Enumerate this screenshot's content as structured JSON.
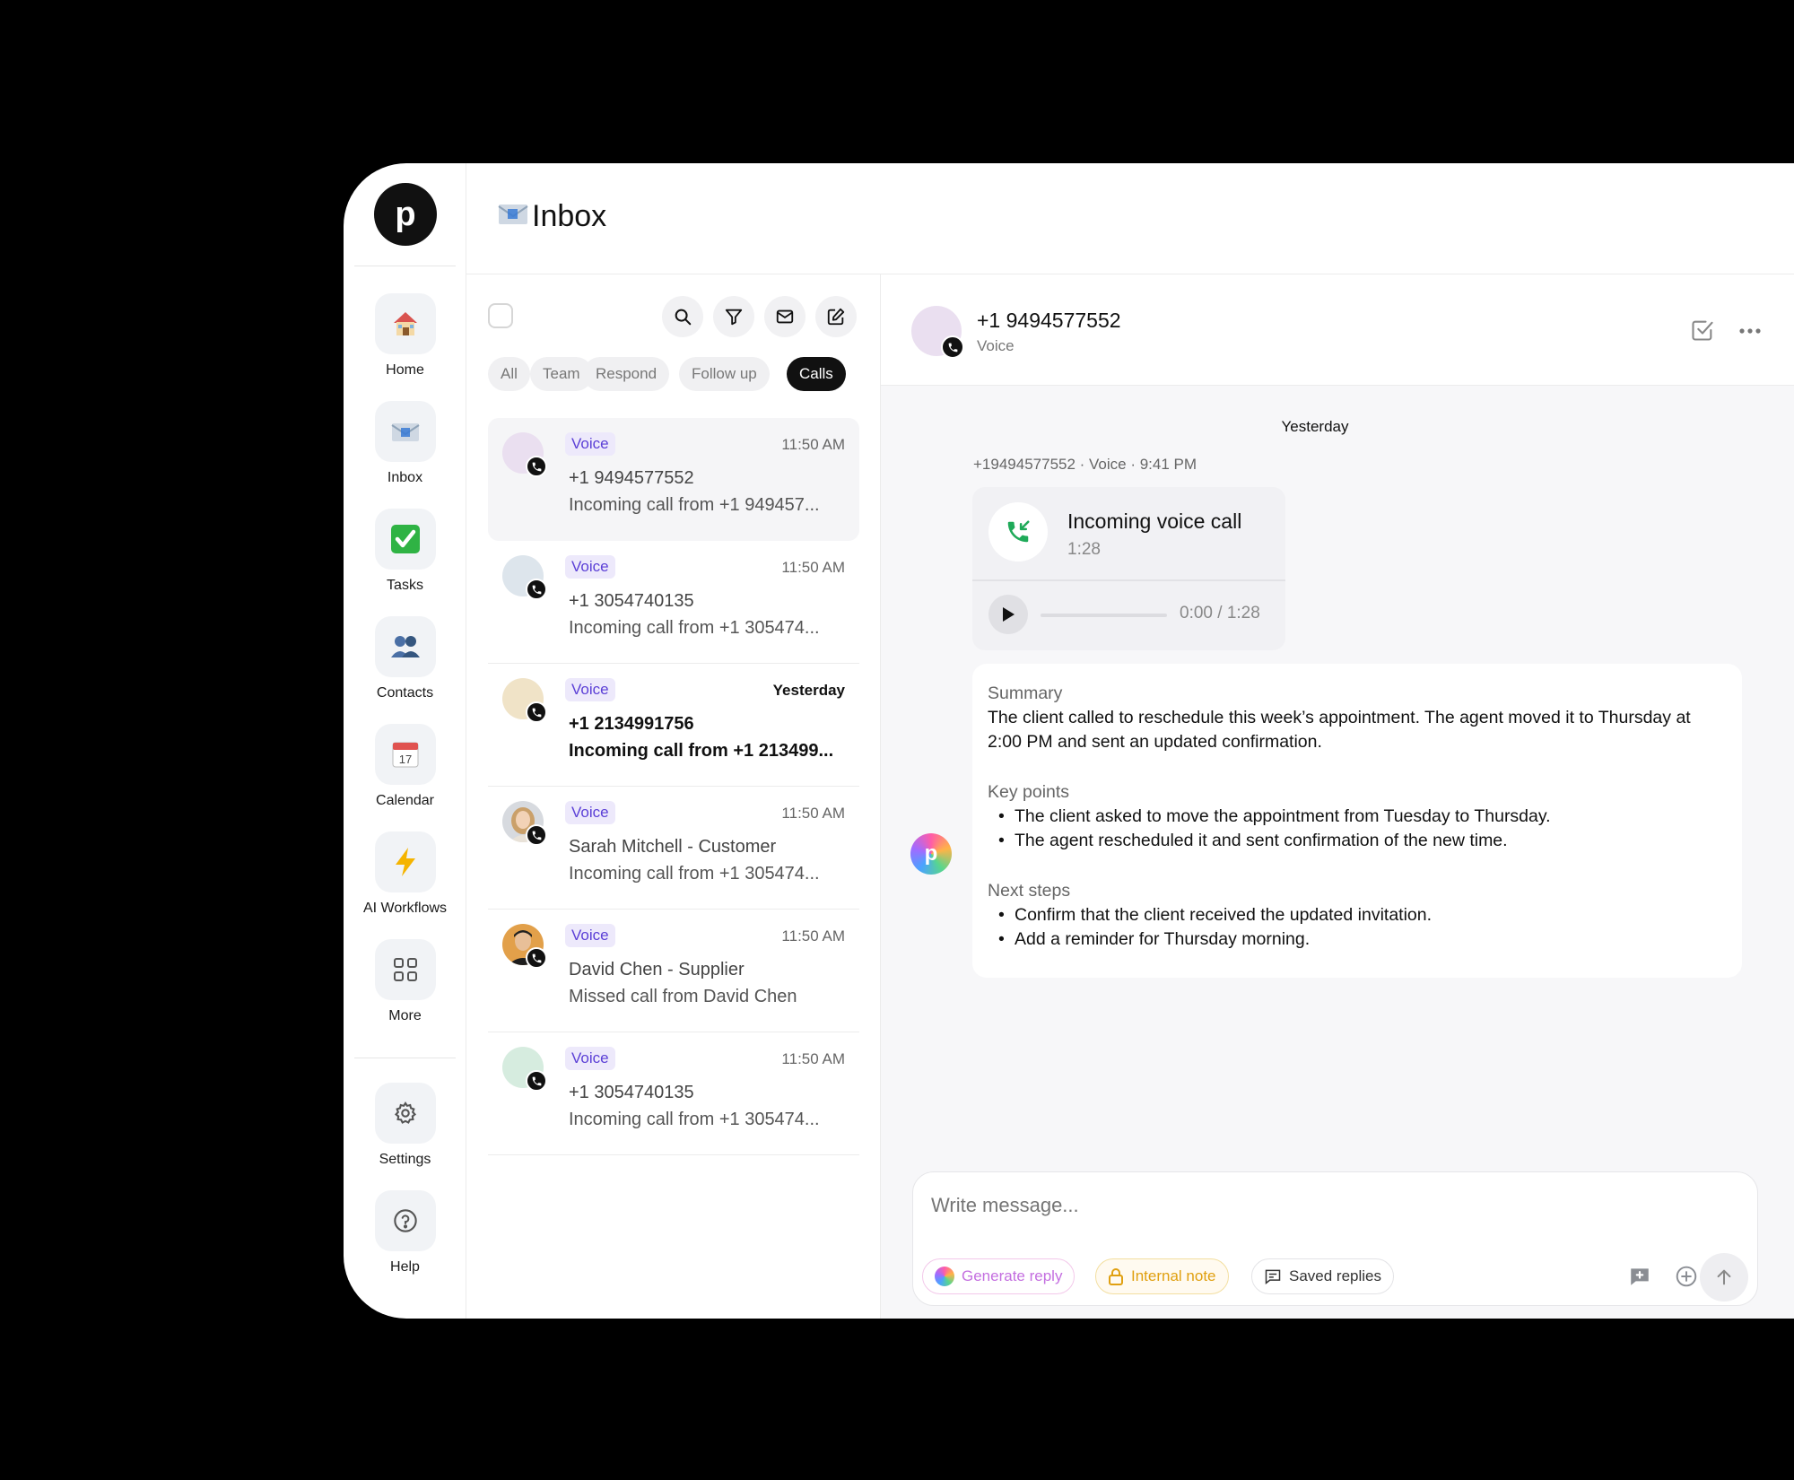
{
  "app": {
    "logo_letter": "p",
    "page_title": "Inbox",
    "accent_color": "#5b3fd6"
  },
  "sidebar": {
    "items": [
      {
        "label": "Home",
        "icon": "house-icon"
      },
      {
        "label": "Inbox",
        "icon": "inbox-icon"
      },
      {
        "label": "Tasks",
        "icon": "check-icon"
      },
      {
        "label": "Contacts",
        "icon": "contacts-icon"
      },
      {
        "label": "Calendar",
        "icon": "calendar-icon"
      },
      {
        "label": "AI Workflows",
        "icon": "lightning-icon"
      },
      {
        "label": "More",
        "icon": "grid-icon"
      }
    ],
    "bottom": [
      {
        "label": "Settings",
        "icon": "gear-icon"
      },
      {
        "label": "Help",
        "icon": "help-icon"
      }
    ]
  },
  "list": {
    "filters": [
      {
        "label": "All",
        "active": false
      },
      {
        "label": "Team",
        "active": false
      },
      {
        "label": "Respond",
        "active": false
      },
      {
        "label": "Follow up",
        "active": false
      },
      {
        "label": "Calls",
        "active": true
      }
    ],
    "conversations": [
      {
        "tag": "Voice",
        "time": "11:50 AM",
        "name": "+1 9494577552",
        "preview": "Incoming call from +1 949457...",
        "selected": true,
        "unread": false,
        "avatar_color": "#eadff0"
      },
      {
        "tag": "Voice",
        "time": "11:50 AM",
        "name": "+1 3054740135",
        "preview": "Incoming call from +1 305474...",
        "selected": false,
        "unread": false,
        "avatar_color": "#dde5ec"
      },
      {
        "tag": "Voice",
        "time": "Yesterday",
        "name": "+1 2134991756",
        "preview": "Incoming call from +1 213499...",
        "selected": false,
        "unread": true,
        "avatar_color": "#f0e3c7"
      },
      {
        "tag": "Voice",
        "time": "11:50 AM",
        "name": "Sarah Mitchell - Customer",
        "preview": "Incoming call from +1 305474...",
        "selected": false,
        "unread": false,
        "avatar_color": "#d9c3b0"
      },
      {
        "tag": "Voice",
        "time": "11:50 AM",
        "name": "David Chen - Supplier",
        "preview": "Missed call from David Chen",
        "selected": false,
        "unread": false,
        "avatar_color": "#e2a04a"
      },
      {
        "tag": "Voice",
        "time": "11:50 AM",
        "name": "+1 3054740135",
        "preview": "Incoming call from +1 305474...",
        "selected": false,
        "unread": false,
        "avatar_color": "#d6ecdf"
      }
    ]
  },
  "detail": {
    "contact_name": "+1 9494577552",
    "contact_channel": "Voice",
    "day_label": "Yesterday",
    "meta": "+19494577552 · Voice · 9:41 PM",
    "call": {
      "title": "Incoming voice call",
      "duration": "1:28",
      "playback": "0:00 / 1:28",
      "progress": 0
    },
    "summary": {
      "summary_title": "Summary",
      "summary_text": "The client called to reschedule this week’s appointment. The agent moved it to Thursday at 2:00 PM and sent an updated confirmation.",
      "key_points_title": "Key points",
      "key_points": [
        "The client asked to move the appointment from Tuesday to Thursday.",
        "The agent rescheduled it and sent confirmation of the new time."
      ],
      "next_steps_title": "Next steps",
      "next_steps": [
        "Confirm that the client received the updated invitation.",
        "Add a reminder for Thursday morning."
      ]
    },
    "ai_avatar_letter": "p"
  },
  "composer": {
    "placeholder": "Write message...",
    "generate_reply": "Generate reply",
    "internal_note": "Internal note",
    "saved_replies": "Saved replies"
  }
}
